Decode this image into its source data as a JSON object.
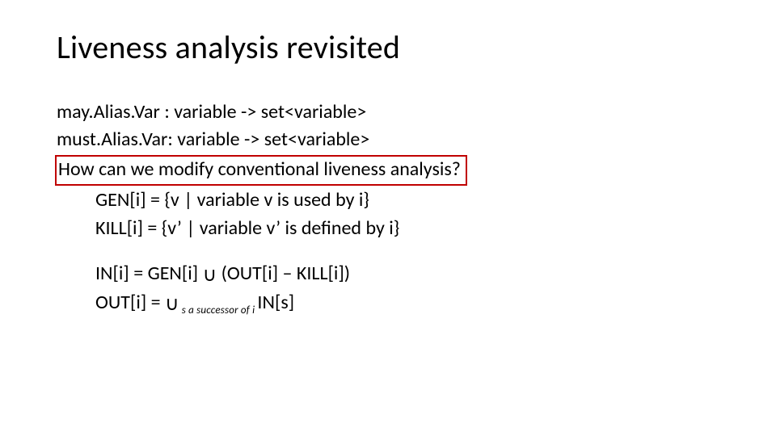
{
  "title": "Liveness analysis revisited",
  "lines": {
    "mayAlias": "may.Alias.Var : variable -> set<variable>",
    "mustAlias": "must.Alias.Var: variable -> set<variable>",
    "question": "How can we modify conventional liveness analysis?",
    "gen": "GEN[i] = {v | variable v is used by i}",
    "kill": "KILL[i]  = {v’ | variable v’ is defined by i}",
    "in_lhs": "IN[i]     = GEN[i] ",
    "in_rhs": " (OUT[i] – KILL[i])",
    "out_lhs": "OUT[i] = ",
    "out_sub": " s a successor of i ",
    "out_rhs": "IN[s]"
  },
  "symbols": {
    "union": "∪"
  }
}
